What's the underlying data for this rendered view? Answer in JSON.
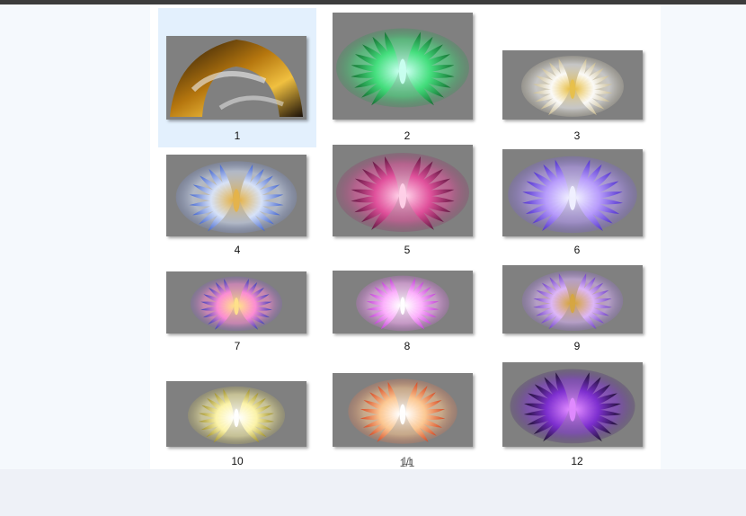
{
  "gallery": {
    "items": [
      {
        "label": "1",
        "icon": "fire-dome-wings-icon",
        "colors": [
          "#1a1008",
          "#b5760e",
          "#f0c040"
        ]
      },
      {
        "label": "2",
        "icon": "green-wings-icon",
        "colors": [
          "#0c6a2a",
          "#3fe07a",
          "#c9fff0"
        ]
      },
      {
        "label": "3",
        "icon": "white-wings-icon",
        "colors": [
          "#c9b98a",
          "#ffffff",
          "#e8c04a"
        ]
      },
      {
        "label": "4",
        "icon": "blue-wings-icon",
        "colors": [
          "#3b5fd0",
          "#d9e6ff",
          "#e5b34a"
        ]
      },
      {
        "label": "5",
        "icon": "crimson-wings-icon",
        "colors": [
          "#5a0f3a",
          "#e24c9a",
          "#ffd0e8"
        ]
      },
      {
        "label": "6",
        "icon": "violet-wings-icon",
        "colors": [
          "#4a2ad0",
          "#b89bff",
          "#f0f0ff"
        ]
      },
      {
        "label": "7",
        "icon": "blue-pink-wings-icon",
        "colors": [
          "#2a3ab8",
          "#ff8ad8",
          "#ffe08a"
        ]
      },
      {
        "label": "8",
        "icon": "magenta-wings-icon",
        "colors": [
          "#c03ad8",
          "#ffb0ff",
          "#ffffff"
        ]
      },
      {
        "label": "9",
        "icon": "lilac-wings-icon",
        "colors": [
          "#6a3ac8",
          "#e0b8ff",
          "#d6a640"
        ]
      },
      {
        "label": "10",
        "icon": "golden-wings-icon",
        "colors": [
          "#9a8a20",
          "#fff6a8",
          "#ffffff"
        ]
      },
      {
        "label": "11",
        "icon": "flame-wings-icon",
        "colors": [
          "#d8401a",
          "#ffc890",
          "#ffffff"
        ]
      },
      {
        "label": "12",
        "icon": "dark-purple-wings-icon",
        "colors": [
          "#140a24",
          "#7a2ad0",
          "#e08aff"
        ]
      }
    ],
    "overlay_text": "1/1"
  }
}
